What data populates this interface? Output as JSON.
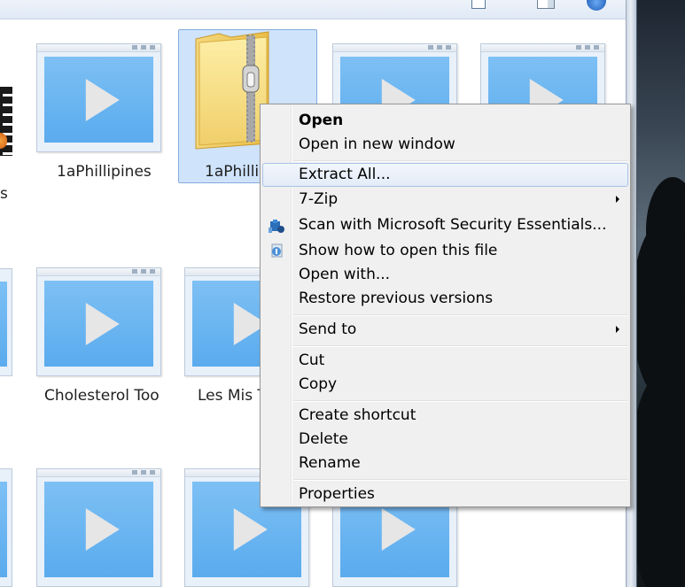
{
  "explorer": {
    "tiles": [
      {
        "label": "1aPhillipines",
        "icon": "video-icon"
      },
      {
        "label": "1aPhillip",
        "icon": "zip-folder-icon",
        "selected": true
      },
      {
        "label": "",
        "icon": "video-icon"
      },
      {
        "label": "",
        "icon": "video-icon"
      },
      {
        "label": "Cholesterol Too",
        "icon": "video-icon"
      },
      {
        "label": "Les Mis T",
        "icon": "video-icon"
      },
      {
        "label": "",
        "icon": "video-icon"
      },
      {
        "label": "",
        "icon": "video-icon"
      },
      {
        "label": "",
        "icon": "video-icon"
      }
    ],
    "partial_label": "s"
  },
  "context_menu": {
    "items": {
      "open": "Open",
      "open_new_window": "Open in new window",
      "extract_all": "Extract All...",
      "seven_zip": "7-Zip",
      "scan_mse": "Scan with Microsoft Security Essentials...",
      "show_how_open": "Show how to open this file",
      "open_with": "Open with...",
      "restore_previous": "Restore previous versions",
      "send_to": "Send to",
      "cut": "Cut",
      "copy": "Copy",
      "create_shortcut": "Create shortcut",
      "delete": "Delete",
      "rename": "Rename",
      "properties": "Properties"
    },
    "highlighted": "extract_all"
  },
  "colors": {
    "menu_bg": "#f0f0f0",
    "selection": "#cfe3fb",
    "video_screen": "#5aabee"
  }
}
